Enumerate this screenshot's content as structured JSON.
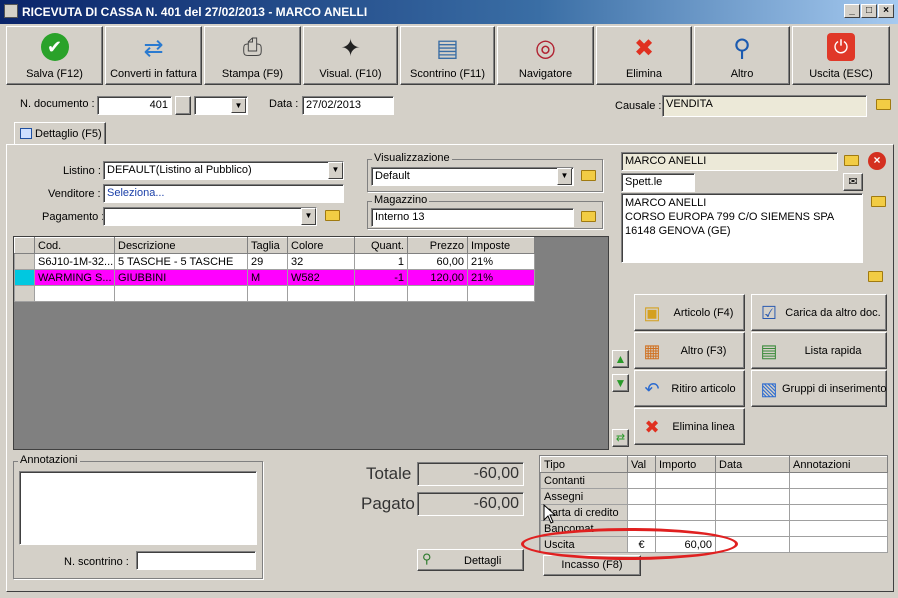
{
  "window": {
    "title": "RICEVUTA DI CASSA N. 401 del 27/02/2013 - MARCO ANELLI"
  },
  "toolbar": [
    {
      "label": "Salva (F12)",
      "icon": "check-icon"
    },
    {
      "label": "Converti in fattura",
      "icon": "convert-icon"
    },
    {
      "label": "Stampa (F9)",
      "icon": "printer-icon"
    },
    {
      "label": "Visual. (F10)",
      "icon": "magic-wand-icon"
    },
    {
      "label": "Scontrino (F11)",
      "icon": "cash-register-icon"
    },
    {
      "label": "Navigatore",
      "icon": "compass-icon"
    },
    {
      "label": "Elimina",
      "icon": "delete-icon"
    },
    {
      "label": "Altro",
      "icon": "search-icon"
    },
    {
      "label": "Uscita (ESC)",
      "icon": "power-icon"
    }
  ],
  "header": {
    "doc_label": "N. documento :",
    "doc_number": "401",
    "data_label": "Data :",
    "data_value": "27/02/2013",
    "causale_label": "Causale :",
    "causale_value": "VENDITA"
  },
  "tab": {
    "label": "Dettaglio (F5)"
  },
  "form": {
    "listino_label": "Listino :",
    "listino_value": "DEFAULT(Listino al Pubblico)",
    "venditore_label": "Venditore :",
    "venditore_value": "Seleziona...",
    "pagamento_label": "Pagamento :",
    "pagamento_value": "",
    "visual_label": "Visualizzazione",
    "visual_value": "Default",
    "magazzino_label": "Magazzino",
    "magazzino_value": "Interno 13"
  },
  "customer": {
    "name": "MARCO ANELLI",
    "title": "Spett.le",
    "address_lines": [
      "MARCO ANELLI",
      "CORSO EUROPA 799 C/O SIEMENS SPA",
      "16148 GENOVA (GE)"
    ]
  },
  "lines_table": {
    "headers": [
      "Cod.",
      "Descrizione",
      "Taglia",
      "Colore",
      "Quant.",
      "Prezzo",
      "Imposte"
    ],
    "rows": [
      [
        "S6J10-1M-32...",
        "5 TASCHE - 5 TASCHE",
        "29",
        "32",
        "1",
        "60,00",
        "21%"
      ],
      [
        "WARMING S...",
        "GIUBBINI",
        "M",
        "W582",
        "-1",
        "120,00",
        "21%"
      ]
    ]
  },
  "actions": [
    {
      "label": "Articolo (F4)",
      "icon": "add-item-icon"
    },
    {
      "label": "Carica da altro doc.",
      "icon": "checklist-icon"
    },
    {
      "label": "Altro (F3)",
      "icon": "grid-add-icon"
    },
    {
      "label": "Lista rapida",
      "icon": "quick-list-icon"
    },
    {
      "label": "Ritiro articolo",
      "icon": "return-icon"
    },
    {
      "label": "Gruppi di inserimento",
      "icon": "group-icon"
    },
    {
      "label": "Elimina linea",
      "icon": "delete-icon"
    }
  ],
  "notes": {
    "label": "Annotazioni",
    "scontrino_label": "N. scontrino :",
    "scontrino_value": ""
  },
  "totals": {
    "totale_label": "Totale",
    "totale_value": "-60,00",
    "pagato_label": "Pagato",
    "pagato_value": "-60,00",
    "dettagli_label": "Dettagli"
  },
  "payments": {
    "headers": [
      "Tipo",
      "Val",
      "Importo",
      "Data",
      "Annotazioni"
    ],
    "rows": [
      {
        "tipo": "Contanti",
        "val": "",
        "importo": ""
      },
      {
        "tipo": "Assegni",
        "val": "",
        "importo": ""
      },
      {
        "tipo": "Carta di credito",
        "val": "",
        "importo": ""
      },
      {
        "tipo": "Bancomat",
        "val": "",
        "importo": ""
      },
      {
        "tipo": "Uscita",
        "val": "€",
        "importo": "60,00"
      }
    ],
    "incasso_label": "Incasso (F8)"
  },
  "colors": {
    "highlight_row": "#ff00ff",
    "annotation_circle": "#e02020",
    "title_bar": "#0a246a"
  }
}
